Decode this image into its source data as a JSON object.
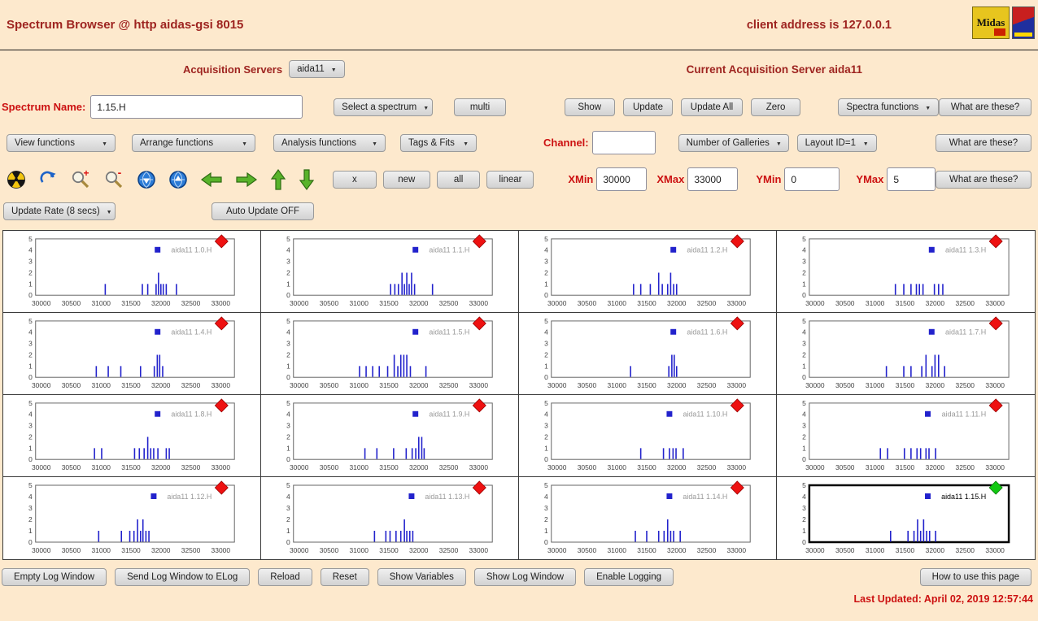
{
  "colors": {
    "page_bg": "#fde9cd",
    "maroon": "#9e2420",
    "red_label": "#cc1111",
    "spike": "#2222cc",
    "status_red": "#ee1111",
    "status_green": "#12c912"
  },
  "header": {
    "title": "Spectrum Browser @ http aidas-gsi 8015",
    "client": "client address is 127.0.0.1",
    "midas_logo_text": "Midas"
  },
  "acquisition": {
    "label": "Acquisition Servers",
    "server_dropdown": "aida11",
    "current": "Current Acquisition Server aida11"
  },
  "spectrum_row": {
    "name_label": "Spectrum Name:",
    "name_value": "1.15.H",
    "select_dropdown": "Select a spectrum",
    "multi_button": "multi",
    "show_button": "Show",
    "update_button": "Update",
    "update_all_button": "Update All",
    "zero_button": "Zero",
    "spectra_functions_dropdown": "Spectra functions",
    "what_button": "What are these?"
  },
  "functions_row": {
    "view_dropdown": "View functions",
    "arrange_dropdown": "Arrange functions",
    "analysis_dropdown": "Analysis functions",
    "tags_dropdown": "Tags & Fits",
    "channel_label": "Channel:",
    "channel_value": "",
    "galleries_dropdown": "Number of Galleries",
    "layout_dropdown": "Layout ID=1",
    "what_button": "What are these?"
  },
  "axis_row": {
    "buttons": [
      "x",
      "new",
      "all",
      "linear"
    ],
    "xmin_label": "XMin",
    "xmin_value": "30000",
    "xmax_label": "XMax",
    "xmax_value": "33000",
    "ymin_label": "YMin",
    "ymin_value": "0",
    "ymax_label": "YMax",
    "ymax_value": "5",
    "what_button": "What are these?"
  },
  "update_row": {
    "rate_dropdown": "Update Rate (8 secs)",
    "auto_update_button": "Auto Update OFF"
  },
  "toolbar_icons": [
    "radiation-icon",
    "refresh-icon",
    "zoom-in-icon",
    "zoom-out-icon",
    "globe-down-icon",
    "globe-up-icon",
    "arrow-left-icon",
    "arrow-right-icon",
    "arrow-up-icon",
    "arrow-down-icon"
  ],
  "footer": {
    "buttons": [
      "Empty Log Window",
      "Send Log Window to ELog",
      "Reload",
      "Reset",
      "Show Variables",
      "Show Log Window",
      "Enable Logging"
    ],
    "help_button": "How to use this page",
    "last_updated": "Last Updated: April 02, 2019 12:57:44"
  },
  "chart_data": {
    "type": "bar",
    "note": "4x4 gallery of sparse histogram spectra; spikes are [x,count] estimates",
    "xlim": [
      30000,
      33000
    ],
    "ylim": [
      0,
      5
    ],
    "x_ticks": [
      30000,
      30500,
      31000,
      31500,
      32000,
      32500,
      33000
    ],
    "y_ticks": [
      0,
      1,
      2,
      3,
      4,
      5
    ],
    "server": "aida11",
    "spectra": [
      {
        "label": "aida11 1.0.H",
        "status": "red",
        "selected": false,
        "spikes": [
          [
            31070,
            1
          ],
          [
            31690,
            1
          ],
          [
            31780,
            1
          ],
          [
            31920,
            1
          ],
          [
            31960,
            2
          ],
          [
            32000,
            1
          ],
          [
            32040,
            1
          ],
          [
            32090,
            1
          ],
          [
            32260,
            1
          ]
        ]
      },
      {
        "label": "aida11 1.1.H",
        "status": "red",
        "selected": false,
        "spikes": [
          [
            31530,
            1
          ],
          [
            31600,
            1
          ],
          [
            31660,
            1
          ],
          [
            31720,
            2
          ],
          [
            31760,
            1
          ],
          [
            31800,
            2
          ],
          [
            31840,
            1
          ],
          [
            31880,
            2
          ],
          [
            31930,
            1
          ],
          [
            32230,
            1
          ]
        ]
      },
      {
        "label": "aida11 1.2.H",
        "status": "red",
        "selected": false,
        "spikes": [
          [
            31280,
            1
          ],
          [
            31400,
            1
          ],
          [
            31560,
            1
          ],
          [
            31700,
            2
          ],
          [
            31760,
            1
          ],
          [
            31850,
            1
          ],
          [
            31900,
            2
          ],
          [
            31950,
            1
          ],
          [
            32000,
            1
          ]
        ]
      },
      {
        "label": "aida11 1.3.H",
        "status": "red",
        "selected": false,
        "spikes": [
          [
            31340,
            1
          ],
          [
            31480,
            1
          ],
          [
            31600,
            1
          ],
          [
            31690,
            1
          ],
          [
            31740,
            1
          ],
          [
            31800,
            1
          ],
          [
            31990,
            1
          ],
          [
            32060,
            1
          ],
          [
            32130,
            1
          ]
        ]
      },
      {
        "label": "aida11 1.4.H",
        "status": "red",
        "selected": false,
        "spikes": [
          [
            30920,
            1
          ],
          [
            31120,
            1
          ],
          [
            31330,
            1
          ],
          [
            31660,
            1
          ],
          [
            31890,
            1
          ],
          [
            31940,
            2
          ],
          [
            31980,
            2
          ],
          [
            32030,
            1
          ]
        ]
      },
      {
        "label": "aida11 1.5.H",
        "status": "red",
        "selected": false,
        "spikes": [
          [
            31010,
            1
          ],
          [
            31120,
            1
          ],
          [
            31230,
            1
          ],
          [
            31340,
            1
          ],
          [
            31480,
            1
          ],
          [
            31590,
            2
          ],
          [
            31650,
            1
          ],
          [
            31700,
            2
          ],
          [
            31750,
            2
          ],
          [
            31800,
            2
          ],
          [
            31860,
            1
          ],
          [
            32120,
            1
          ]
        ]
      },
      {
        "label": "aida11 1.6.H",
        "status": "red",
        "selected": false,
        "spikes": [
          [
            31230,
            1
          ],
          [
            31870,
            1
          ],
          [
            31920,
            2
          ],
          [
            31960,
            2
          ],
          [
            32000,
            1
          ]
        ]
      },
      {
        "label": "aida11 1.7.H",
        "status": "red",
        "selected": false,
        "spikes": [
          [
            31190,
            1
          ],
          [
            31480,
            1
          ],
          [
            31600,
            1
          ],
          [
            31780,
            1
          ],
          [
            31850,
            2
          ],
          [
            31950,
            1
          ],
          [
            32000,
            2
          ],
          [
            32060,
            2
          ],
          [
            32160,
            1
          ]
        ]
      },
      {
        "label": "aida11 1.8.H",
        "status": "red",
        "selected": false,
        "spikes": [
          [
            30890,
            1
          ],
          [
            31010,
            1
          ],
          [
            31560,
            1
          ],
          [
            31640,
            1
          ],
          [
            31720,
            1
          ],
          [
            31780,
            2
          ],
          [
            31830,
            1
          ],
          [
            31880,
            1
          ],
          [
            31950,
            1
          ],
          [
            32090,
            1
          ],
          [
            32140,
            1
          ]
        ]
      },
      {
        "label": "aida11 1.9.H",
        "status": "red",
        "selected": false,
        "spikes": [
          [
            31100,
            1
          ],
          [
            31300,
            1
          ],
          [
            31580,
            1
          ],
          [
            31790,
            1
          ],
          [
            31890,
            1
          ],
          [
            31950,
            1
          ],
          [
            32000,
            2
          ],
          [
            32050,
            2
          ],
          [
            32090,
            1
          ]
        ]
      },
      {
        "label": "aida11 1.10.H",
        "status": "red",
        "selected": false,
        "spikes": [
          [
            31400,
            1
          ],
          [
            31780,
            1
          ],
          [
            31880,
            1
          ],
          [
            31940,
            1
          ],
          [
            31990,
            1
          ],
          [
            32110,
            1
          ]
        ]
      },
      {
        "label": "aida11 1.11.H",
        "status": "red",
        "selected": false,
        "spikes": [
          [
            31090,
            1
          ],
          [
            31210,
            1
          ],
          [
            31490,
            1
          ],
          [
            31600,
            1
          ],
          [
            31700,
            1
          ],
          [
            31760,
            1
          ],
          [
            31850,
            1
          ],
          [
            31900,
            1
          ],
          [
            32010,
            1
          ]
        ]
      },
      {
        "label": "aida11 1.12.H",
        "status": "red",
        "selected": false,
        "spikes": [
          [
            30960,
            1
          ],
          [
            31340,
            1
          ],
          [
            31480,
            1
          ],
          [
            31550,
            1
          ],
          [
            31610,
            2
          ],
          [
            31660,
            1
          ],
          [
            31700,
            2
          ],
          [
            31750,
            1
          ],
          [
            31800,
            1
          ]
        ]
      },
      {
        "label": "aida11 1.13.H",
        "status": "red",
        "selected": false,
        "spikes": [
          [
            31260,
            1
          ],
          [
            31450,
            1
          ],
          [
            31520,
            1
          ],
          [
            31620,
            1
          ],
          [
            31700,
            1
          ],
          [
            31760,
            2
          ],
          [
            31800,
            1
          ],
          [
            31850,
            1
          ],
          [
            31900,
            1
          ]
        ]
      },
      {
        "label": "aida11 1.14.H",
        "status": "red",
        "selected": false,
        "spikes": [
          [
            31310,
            1
          ],
          [
            31500,
            1
          ],
          [
            31700,
            1
          ],
          [
            31790,
            1
          ],
          [
            31850,
            2
          ],
          [
            31900,
            1
          ],
          [
            31950,
            1
          ],
          [
            32060,
            1
          ]
        ]
      },
      {
        "label": "aida11 1.15.H",
        "status": "green",
        "selected": true,
        "spikes": [
          [
            31260,
            1
          ],
          [
            31550,
            1
          ],
          [
            31650,
            1
          ],
          [
            31710,
            2
          ],
          [
            31760,
            1
          ],
          [
            31810,
            2
          ],
          [
            31860,
            1
          ],
          [
            31910,
            1
          ],
          [
            32010,
            1
          ]
        ]
      }
    ]
  }
}
